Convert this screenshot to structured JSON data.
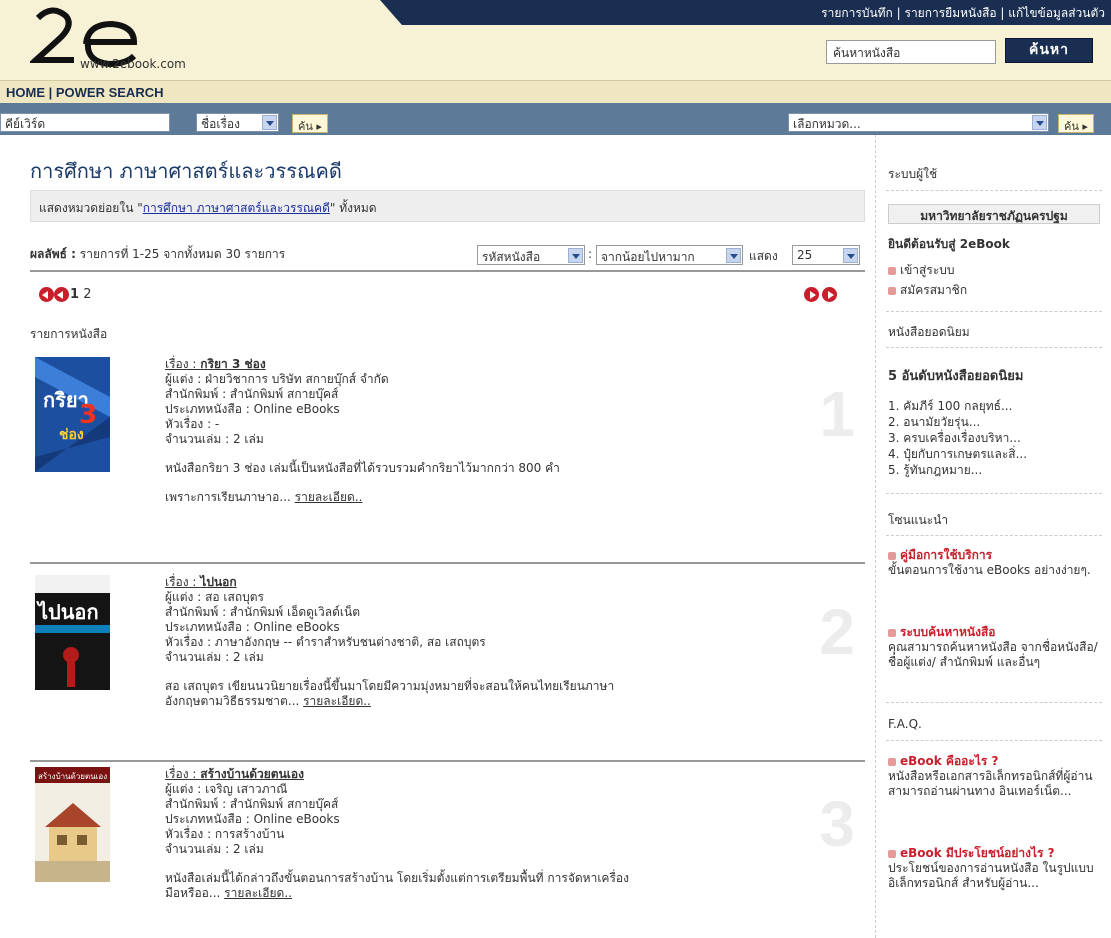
{
  "header": {
    "logo_text": "www.2ebook.com",
    "top_links": [
      "รายการบันทึก",
      "รายการยืมหนังสือ",
      "แก้ไขข้อมูลส่วนตัว"
    ],
    "search_placeholder": "ค้นหาหนังสือ",
    "search_button": "ค้นหา"
  },
  "nav": {
    "text": "HOME | POWER SEARCH"
  },
  "filter": {
    "keyword_placeholder": "คีย์เวิร์ด",
    "field_select": "ชื่อเรื่อง",
    "go_button": "ค้น",
    "category_select": "เลือกหมวด...",
    "go_button2": "ค้น"
  },
  "main": {
    "page_title": "การศึกษา ภาษาศาสตร์และวรรณคดี",
    "sub_prefix": "แสดงหมวดย่อยใน \"",
    "sub_link": "การศึกษา ภาษาศาสตร์และวรรณคดี",
    "sub_suffix": "\" ทั้งหมด",
    "result_label": "ผลลัพธ์ :",
    "result_text": "รายการที่ 1-25 จากทั้งหมด 30 รายการ",
    "sort_select": "รหัสหนังสือ",
    "order_select": "จากน้อยไปหามาก",
    "show_label": "แสดง",
    "show_select": "25",
    "page_current": "1",
    "page_next": "2",
    "list_title": "รายการหนังสือ"
  },
  "books": [
    {
      "num": "1",
      "title_prefix": "เรื่อง : ",
      "title": "กริยา 3 ช่อง",
      "author": "ผู้แต่ง : ฝ่ายวิชาการ บริษัท สกายบุ๊กส์ จำกัด",
      "publisher": "สำนักพิมพ์ : สำนักพิมพ์ สกายบุ๊คส์",
      "type": "ประเภทหนังสือ : Online eBooks",
      "subject": "หัวเรื่อง : -",
      "copies": "จำนวนเล่ม : 2 เล่ม",
      "desc": "หนังสือกริยา 3 ช่อง เล่มนี้เป็นหนังสือที่ได้รวบรวมคำกริยาไว้มากกว่า 800 คำ",
      "desc2": "เพราะการเรียนภาษาอ...",
      "more": "รายละเอียด.."
    },
    {
      "num": "2",
      "title_prefix": "เรื่อง : ",
      "title": "ไปนอก",
      "author": "ผู้แต่ง : สอ เสถบุตร",
      "publisher": "สำนักพิมพ์ : สำนักพิมพ์ เอ็ดดูเวิลด์เน็ต",
      "type": "ประเภทหนังสือ : Online eBooks",
      "subject": "หัวเรื่อง : ภาษาอังกฤษ -- ตำราสำหรับชนต่างชาติ, สอ เสถบุตร",
      "copies": "จำนวนเล่ม : 2 เล่ม",
      "desc": "สอ เสถบุตร เขียนนวนิยายเรื่องนี้ขึ้นมาโดยมีความมุ่งหมายที่จะสอนให้คนไทยเรียนภาษา",
      "desc2": "อังกฤษตามวิธีธรรมชาต...",
      "more": "รายละเอียด.."
    },
    {
      "num": "3",
      "title_prefix": "เรื่อง : ",
      "title": "สร้างบ้านด้วยตนเอง",
      "author": "ผู้แต่ง : เจริญ เสาวภาณี",
      "publisher": "สำนักพิมพ์ : สำนักพิมพ์ สกายบุ๊คส์",
      "type": "ประเภทหนังสือ : Online eBooks",
      "subject": "หัวเรื่อง : การสร้างบ้าน",
      "copies": "จำนวนเล่ม : 2 เล่ม",
      "desc": "หนังสือเล่มนี้ได้กล่าวถึงขั้นตอนการสร้างบ้าน โดยเริ่มตั้งแต่การเตรียมพื้นที่ การจัดหาเครื่อง",
      "desc2": "มือหรืออ...",
      "more": "รายละเอียด.."
    }
  ],
  "cover_texts": [
    "กริยา",
    "3",
    "ช่อง",
    "ไปนอก",
    "สร้างบ้านด้วยตนเอง"
  ],
  "sidebar": {
    "user_heading": "ระบบผู้ใช้",
    "university": "มหาวิทยาลัยราชภัฏนครปฐม",
    "welcome": "ยินดีต้อนรับสู่ 2eBook",
    "login": "เข้าสู่ระบบ",
    "register": "สมัครสมาชิก",
    "popular_heading": "หนังสือยอดนิยม",
    "top5_title": "5 อันดับหนังสือยอดนิยม",
    "top5": [
      "1. คัมภีร์ 100 กลยุทธ์...",
      "2. อนามัยวัยรุ่น...",
      "3. ครบเครื่องเรื่องบริหา...",
      "4. ปุ๋ยกับการเกษตรและสิ่...",
      "5. รู้ทันกฎหมาย..."
    ],
    "recommend_heading": "โซนแนะนำ",
    "rec1_title": "คู่มือการใช้บริการ",
    "rec1_text": "ขั้นตอนการใช้งาน eBooks อย่างง่ายๆ.",
    "rec2_title": "ระบบค้นหาหนังสือ",
    "rec2_text": "คุณสามารถค้นหาหนังสือ จากชื่อหนังสือ/ ชื่อผู้แต่ง/ สำนักพิมพ์ และอื่นๆ",
    "faq_heading": "F.A.Q.",
    "faq1_title": "eBook คืออะไร ?",
    "faq1_text": "หนังสือหรือเอกสารอิเล็กทรอนิกส์ที่ผู้อ่านสามารถอ่านผ่านทาง อินเทอร์เน็ต...",
    "faq2_title": "eBook มีประโยชน์อย่างไร ?",
    "faq2_text": "ประโยชน์ของการอ่านหนังสือ ในรูปแบบอิเล็กทรอนิกส์ สำหรับผู้อ่าน..."
  },
  "colors": {
    "navy": "#1a2e52",
    "filter_bar": "#5d7a99",
    "accent_red": "#c91f2b",
    "header_bg": "#f7f1d6"
  }
}
